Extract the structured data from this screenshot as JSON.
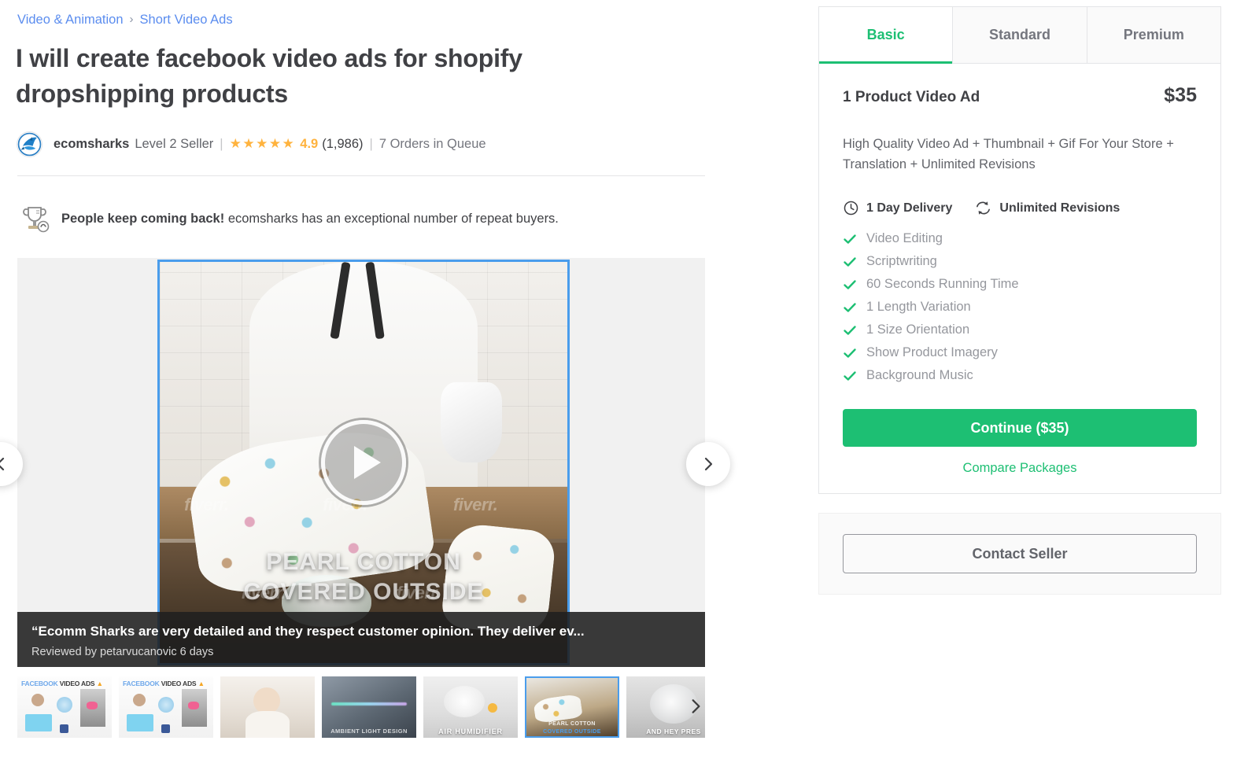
{
  "breadcrumb": {
    "items": [
      {
        "label": "Video & Animation"
      },
      {
        "label": "Short Video Ads"
      }
    ],
    "separator": "›"
  },
  "gig": {
    "title": "I will create facebook video ads for shopify dropshipping products"
  },
  "seller": {
    "avatar_icon": "shark-avatar-icon",
    "name": "ecomsharks",
    "level": "Level 2 Seller",
    "stars": "★★★★★",
    "rating": "4.9",
    "reviews_count": "(1,986)",
    "orders_in_queue": "7 Orders in Queue",
    "separator": "|"
  },
  "repeat_banner": {
    "icon": "trophy-repeat-icon",
    "headline": "People keep coming back!",
    "body": "ecomsharks has an exceptional number of repeat buyers."
  },
  "gallery": {
    "prev_icon": "chevron-left-icon",
    "next_icon": "chevron-right-icon",
    "play_icon": "play-icon",
    "slide_caption_line1": "PEARL COTTON",
    "slide_caption_line2": "COVERED OUTSIDE",
    "watermark": "fiverr.",
    "review_overlay": {
      "quote": "“Ecomm Sharks are very detailed and they respect customer opinion. They deliver ev...",
      "byline": "Reviewed by petarvucanovic 6 days"
    },
    "thumbnails_next_icon": "chevron-right-icon",
    "thumbnails": [
      {
        "name": "thumb-facebook-video-ads-1",
        "kind": "fb",
        "hdr_blue": "FACEBOOK",
        "hdr_white": "VIDEO ADS",
        "hdr_orange": "▲",
        "selected": false
      },
      {
        "name": "thumb-facebook-video-ads-2",
        "kind": "fb",
        "hdr_blue": "FACEBOOK",
        "hdr_white": "VIDEO ADS",
        "hdr_orange": "▲",
        "selected": false
      },
      {
        "name": "thumb-baby",
        "kind": "baby",
        "caption": "",
        "selected": false
      },
      {
        "name": "thumb-dark-light-device",
        "kind": "dark",
        "caption": "AMBIENT LIGHT DESIGN",
        "selected": false
      },
      {
        "name": "thumb-air-humidifier",
        "kind": "hum",
        "caption": "AIR HUMIDIFIER",
        "selected": false
      },
      {
        "name": "thumb-pearl-cotton",
        "kind": "pearl",
        "caption1": "PEARL COTTON",
        "caption2": "COVERED OUTSIDE",
        "selected": true
      },
      {
        "name": "thumb-and-hey",
        "kind": "hey",
        "caption": "AND HEY PRES",
        "selected": false
      }
    ]
  },
  "package_panel": {
    "tabs": [
      {
        "label": "Basic",
        "active": true
      },
      {
        "label": "Standard",
        "active": false
      },
      {
        "label": "Premium",
        "active": false
      }
    ],
    "package_name": "1 Product Video Ad",
    "price": "$35",
    "description": "High Quality Video Ad + Thumbnail + Gif For Your Store + Translation + Unlimited Revisions",
    "delivery": {
      "icon": "clock-icon",
      "label": "1 Day Delivery"
    },
    "revisions": {
      "icon": "refresh-icon",
      "label": "Unlimited Revisions"
    },
    "features": [
      {
        "label": "Video Editing"
      },
      {
        "label": "Scriptwriting"
      },
      {
        "label": "60 Seconds Running Time"
      },
      {
        "label": "1 Length Variation"
      },
      {
        "label": "1 Size Orientation"
      },
      {
        "label": "Show Product Imagery"
      },
      {
        "label": "Background Music"
      }
    ],
    "continue_label": "Continue ($35)",
    "compare_label": "Compare Packages"
  },
  "contact": {
    "button_label": "Contact Seller"
  },
  "colors": {
    "brand_green": "#1dbf73",
    "link_blue": "#5b8def",
    "star_orange": "#ffb33e",
    "text_dark": "#404145",
    "text_muted": "#74767e",
    "feature_gray": "#95979d",
    "selected_border": "#4a9dec"
  }
}
